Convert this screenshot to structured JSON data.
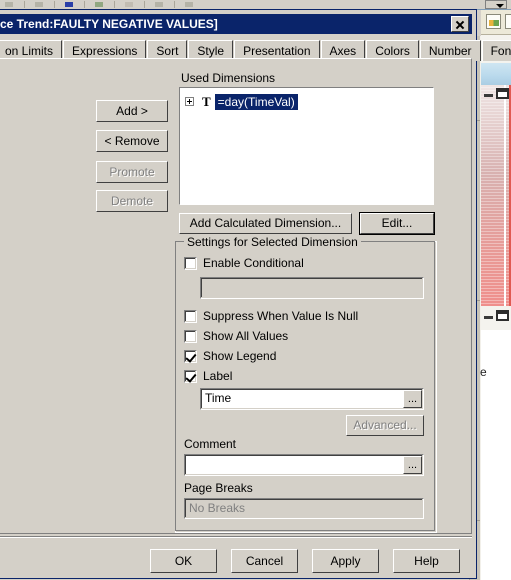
{
  "window": {
    "title": "ce Trend:FAULTY NEGATIVE VALUES]",
    "close_label": "✕"
  },
  "tabs": [
    {
      "label": "on Limits"
    },
    {
      "label": "Expressions"
    },
    {
      "label": "Sort"
    },
    {
      "label": "Style"
    },
    {
      "label": "Presentation"
    },
    {
      "label": "Axes"
    },
    {
      "label": "Colors"
    },
    {
      "label": "Number"
    },
    {
      "label": "Font"
    }
  ],
  "tab_scroll": {
    "left_icon": "left-arrow-icon",
    "right_icon": "right-arrow-icon"
  },
  "side_buttons": [
    {
      "label": "Add >",
      "enabled": true
    },
    {
      "label": "< Remove",
      "enabled": true
    },
    {
      "label": "Promote",
      "enabled": false
    },
    {
      "label": "Demote",
      "enabled": false
    }
  ],
  "used_dimensions": {
    "caption": "Used Dimensions",
    "items": [
      {
        "expander": "plus",
        "type_icon": "T",
        "label": "=day(TimeVal)",
        "selected": true
      }
    ]
  },
  "dimension_actions": {
    "add_calculated": "Add Calculated Dimension...",
    "edit": "Edit..."
  },
  "settings_group": {
    "title": "Settings for Selected Dimension",
    "enable_conditional": {
      "label": "Enable Conditional",
      "checked": false
    },
    "conditional_value": "",
    "suppress_when_null": {
      "label": "Suppress When Value Is Null",
      "checked": false
    },
    "show_all_values": {
      "label": "Show All Values",
      "checked": false
    },
    "show_legend": {
      "label": "Show Legend",
      "checked": true
    },
    "label_checkbox": {
      "label": "Label",
      "checked": true
    },
    "label_value": "Time",
    "label_browse": "...",
    "advanced_button": {
      "label": "Advanced...",
      "enabled": false
    },
    "comment_label": "Comment",
    "comment_value": "",
    "comment_browse": "...",
    "page_breaks_label": "Page Breaks",
    "page_breaks_value": "No Breaks"
  },
  "footer_buttons": [
    {
      "label": "OK"
    },
    {
      "label": "Cancel"
    },
    {
      "label": "Apply"
    },
    {
      "label": "Help"
    }
  ],
  "colors": {
    "titlebar": "#0a246a",
    "dialog_face": "#d4d0c8",
    "selection": "#0a246a",
    "disabled_text": "#808080"
  }
}
